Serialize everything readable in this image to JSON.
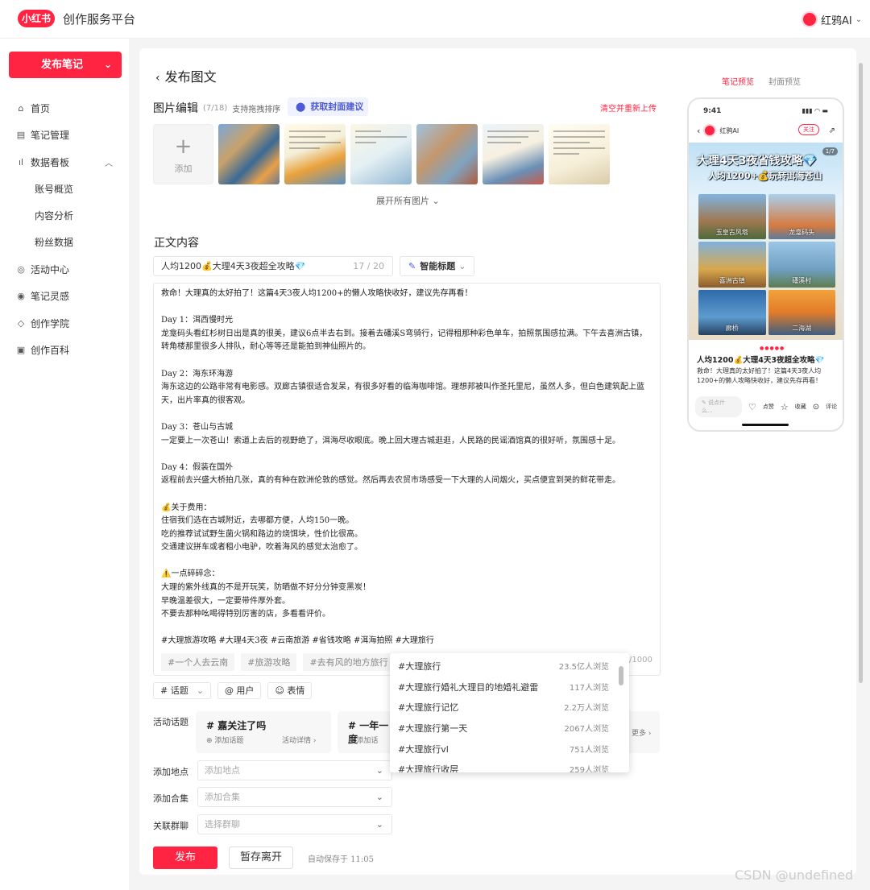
{
  "header": {
    "logo": "小红书",
    "platform": "创作服务平台",
    "user": "红鸦AI"
  },
  "sidebar": {
    "publish": "发布笔记",
    "items": [
      {
        "label": "首页",
        "icon": "home-icon",
        "glyph": "⌂"
      },
      {
        "label": "笔记管理",
        "icon": "note-icon",
        "glyph": "▤"
      },
      {
        "label": "数据看板",
        "icon": "chart-icon",
        "glyph": "ıl"
      },
      {
        "label": "账号概览"
      },
      {
        "label": "内容分析"
      },
      {
        "label": "粉丝数据"
      },
      {
        "label": "活动中心",
        "icon": "activity-icon",
        "glyph": "◎"
      },
      {
        "label": "笔记灵感",
        "icon": "inspiration-icon",
        "glyph": "◉"
      },
      {
        "label": "创作学院",
        "icon": "academy-icon",
        "glyph": "◇"
      },
      {
        "label": "创作百科",
        "icon": "wiki-icon",
        "glyph": "▣"
      }
    ]
  },
  "page": {
    "back_title": "发布图文"
  },
  "images": {
    "title": "图片编辑",
    "count": "(7/18)",
    "hint": "支持拖拽排序",
    "cover_btn": "获取封面建议",
    "clear": "清空并重新上传",
    "add": "添加",
    "expand": "展开所有图片"
  },
  "body": {
    "section": "正文内容",
    "title_value": "人均1200💰大理4天3夜超全攻略💎",
    "title_count": "17 / 20",
    "ai_title": "智能标题",
    "lines": [
      "救命！大理真的太好拍了！这篇4天3夜人均1200+的懒人攻略快收好，建议先存再看！",
      "",
      "Day 1：洱西慢时光",
      "龙龛码头看红杉树日出是真的很美，建议6点半去右到。接着去磻溪S弯骑行，记得租那种彩色单车，拍照氛围感拉满。下午去喜洲古镇，转角楼那里很多人排队，耐心等等还是能拍到神仙照片的。",
      "",
      "Day 2：海东环海游",
      "海东这边的公路非常有电影感。双廊古镇很适合发呆，有很多好看的临海咖啡馆。理想邦被叫作圣托里尼，虽然人多，但白色建筑配上蓝天，出片率真的很客观。",
      "",
      "Day 3：苍山与古城",
      "一定要上一次苍山！索道上去后的视野绝了，洱海尽收眼底。晚上回大理古城逛逛，人民路的民谣酒馆真的很好听，氛围感十足。",
      "",
      "Day 4：假装在国外",
      "返程前去兴盛大桥拍几张，真的有种在欧洲伦敦的感觉。然后再去农贸市场感受一下大理的人间烟火，买点便宜到哭的鲜花带走。",
      "",
      "💰关于费用：",
      "住宿我们选在古城附近，去哪都方便，人均150一晚。",
      "吃的推荐试试野生菌火锅和路边的烧饵块，性价比很高。",
      "交通建议拼车或者租小电驴，吹着海风的感觉太治愈了。",
      "",
      "⚠️一点碎碎念：",
      "大理的紫外线真的不是开玩笑，防晒做不好分分钟变黑炭！",
      "早晚温差很大，一定要带件厚外套。",
      "不要去那种吆喝得特别厉害的店，多看看评价。",
      "",
      "#大理旅游攻略 #大理4天3夜 #云南旅游 #省钱攻略 #洱海拍照 #大理旅行"
    ],
    "tag_chips": [
      "#一个人去云南",
      "#旅游攻略",
      "#去有风的地方旅行"
    ],
    "counter": "/1000"
  },
  "toolbar": {
    "topic": "# 话题",
    "user": "@ 用户",
    "emoji": "☺ 表情"
  },
  "activity": {
    "label": "活动话题",
    "cards": [
      {
        "title": "# 嘉关注了吗",
        "add": "⊕ 添加话题",
        "detail": "活动详情 ›"
      },
      {
        "title": "# 一年一度",
        "add": "⊕ 添加话"
      }
    ],
    "more": "更多 ›"
  },
  "fields": {
    "location_label": "添加地点",
    "location_ph": "添加地点",
    "collection_label": "添加合集",
    "collection_ph": "添加合集",
    "group_label": "关联群聊",
    "group_ph": "选择群聊"
  },
  "dropdown": [
    {
      "tag": "#大理旅行",
      "views": "23.5亿人浏览"
    },
    {
      "tag": "#大理旅行婚礼大理目的地婚礼避雷",
      "views": "117人浏览"
    },
    {
      "tag": "#大理旅行记忆",
      "views": "2.2万人浏览"
    },
    {
      "tag": "#大理旅行第一天",
      "views": "2067人浏览"
    },
    {
      "tag": "#大理旅行vl",
      "views": "751人浏览"
    },
    {
      "tag": "#大理旅行收层",
      "views": "259人浏览"
    }
  ],
  "footer": {
    "publish": "发布",
    "draft": "暂存离开",
    "autosave": "自动保存于 11:05"
  },
  "preview": {
    "tab_note": "笔记预览",
    "tab_cover": "封面预览",
    "time": "9:41",
    "status": "▮▮▮ ◠ ▬",
    "author": "红鸦AI",
    "follow": "关注",
    "cover_title": "大理4天3夜省钱攻略💎",
    "cover_sub": "人均1200+💰玩转洱海苍山",
    "page": "1/7",
    "spots": [
      "玉皇古风塔",
      "龙龛码头",
      "喜洲古镇",
      "磻溪村",
      "廊桥",
      "二海湖"
    ],
    "dots": "●●●●●",
    "note_title": "人均1200💰大理4天3夜超全攻略💎",
    "note_text": "救命！大理真的太好拍了！这篇4天3夜人均1200+的懒人攻略快收好，建议先存再看！",
    "input_ph": "说点什么...",
    "like": "点赞",
    "fav": "收藏",
    "comment": "评论"
  },
  "watermark": "CSDN @undefined",
  "colors": {
    "brand": "#ff2442",
    "link": "#4e5bd6"
  }
}
